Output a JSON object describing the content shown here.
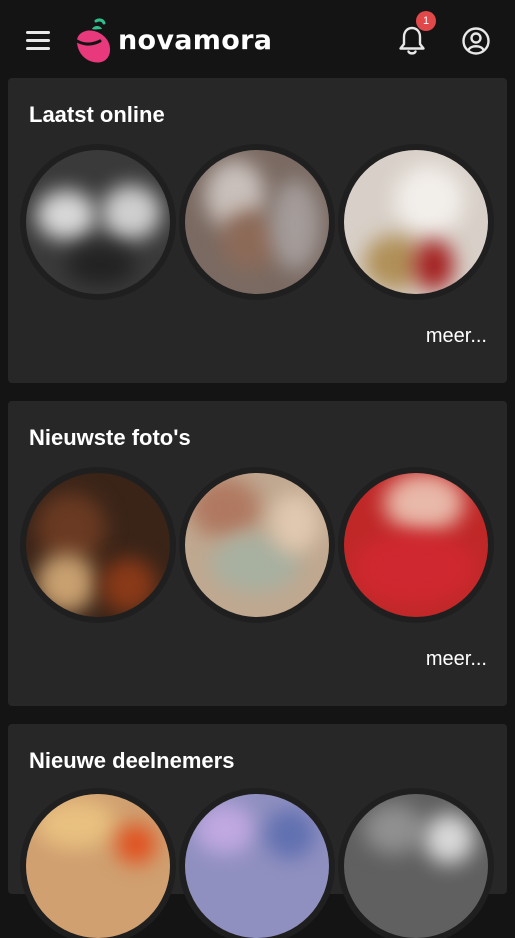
{
  "header": {
    "brand_name": "novamora",
    "notification_count": "1",
    "icons": [
      "hamburger-menu-icon",
      "pepper-logo-icon",
      "bell-icon",
      "user-circle-icon"
    ],
    "colors": {
      "brand_pink": "#e8397c",
      "leaf_green": "#2fbf8b",
      "badge_red": "#e0484a",
      "background": "#141414",
      "card": "#272727"
    }
  },
  "sections": [
    {
      "title": "Laatst online",
      "more_label": "meer..."
    },
    {
      "title": "Nieuwste foto's",
      "more_label": "meer..."
    },
    {
      "title": "Nieuwe deelnemers"
    }
  ]
}
